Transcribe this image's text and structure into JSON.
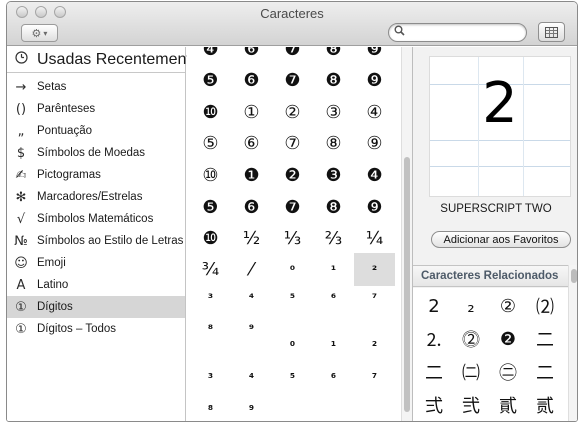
{
  "window": {
    "title": "Caracteres"
  },
  "toolbar": {
    "gear_glyph": "⚙",
    "gear_caret": "▾"
  },
  "search": {
    "value": "",
    "placeholder": ""
  },
  "sidebar": {
    "recent": {
      "icon": "clock-icon",
      "glyph": "◷",
      "label": "Usadas Recentemente"
    },
    "items": [
      {
        "icon": "arrow-icon",
        "glyph": "→",
        "label": "Setas",
        "selected": false
      },
      {
        "icon": "parentheses-icon",
        "glyph": "()",
        "label": "Parênteses",
        "selected": false
      },
      {
        "icon": "punctuation-icon",
        "glyph": "„",
        "label": "Pontuação",
        "selected": false
      },
      {
        "icon": "dollar-icon",
        "glyph": "$",
        "label": "Símbolos de Moedas",
        "selected": false
      },
      {
        "icon": "pictogram-icon",
        "glyph": "✍",
        "label": "Pictogramas",
        "selected": false
      },
      {
        "icon": "asterisk-icon",
        "glyph": "✻",
        "label": "Marcadores/Estrelas",
        "selected": false
      },
      {
        "icon": "square-root-icon",
        "glyph": "√",
        "label": "Símbolos Matemáticos",
        "selected": false
      },
      {
        "icon": "numero-icon",
        "glyph": "№",
        "label": "Símbolos ao Estilo de Letras",
        "selected": false
      },
      {
        "icon": "smiley-icon",
        "glyph": "☺",
        "label": "Emoji",
        "selected": false
      },
      {
        "icon": "latin-a-icon",
        "glyph": "A",
        "label": "Latino",
        "selected": false
      },
      {
        "icon": "circled-one-icon",
        "glyph": "①",
        "label": "Dígitos",
        "selected": true
      },
      {
        "icon": "circled-one-icon",
        "glyph": "①",
        "label": "Dígitos – Todos",
        "selected": false
      }
    ]
  },
  "characters": {
    "rows": [
      [
        "❹",
        "❻",
        "❼",
        "❽",
        "❾"
      ],
      [
        "❺",
        "❻",
        "❼",
        "❽",
        "❾"
      ],
      [
        "❿",
        "①",
        "②",
        "③",
        "④"
      ],
      [
        "⑤",
        "⑥",
        "⑦",
        "⑧",
        "⑨"
      ],
      [
        "⑩",
        "❶",
        "❷",
        "❸",
        "❹"
      ],
      [
        "❺",
        "❻",
        "❼",
        "❽",
        "❾"
      ],
      [
        "❿",
        "½",
        "⅓",
        "⅔",
        "¼"
      ],
      [
        "¾",
        "⁄",
        "⁰",
        "¹",
        "²"
      ],
      [
        "³",
        "⁴",
        "⁵",
        "⁶",
        "⁷"
      ],
      [
        "⁸",
        "⁹",
        "",
        "",
        ""
      ],
      [
        "",
        "",
        "₀",
        "₁",
        "₂"
      ],
      [
        "",
        "",
        "",
        "",
        ""
      ],
      [
        "₃",
        "₄",
        "₅",
        "₆",
        "₇"
      ],
      [
        "₈",
        "₉",
        "",
        "",
        ""
      ]
    ],
    "selected": "²"
  },
  "detail": {
    "glyph": "2",
    "name": "SUPERSCRIPT TWO",
    "favorites_label": "Adicionar aos Favoritos",
    "related_title": "Caracteres Relacionados",
    "related": [
      [
        "2",
        "₂",
        "②",
        "⑵"
      ],
      [
        "⒉",
        "⓶",
        "❷",
        "二"
      ],
      [
        "二",
        "㈡",
        "㊁",
        "二"
      ],
      [
        "弍",
        "弐",
        "貳",
        "贰"
      ]
    ]
  }
}
